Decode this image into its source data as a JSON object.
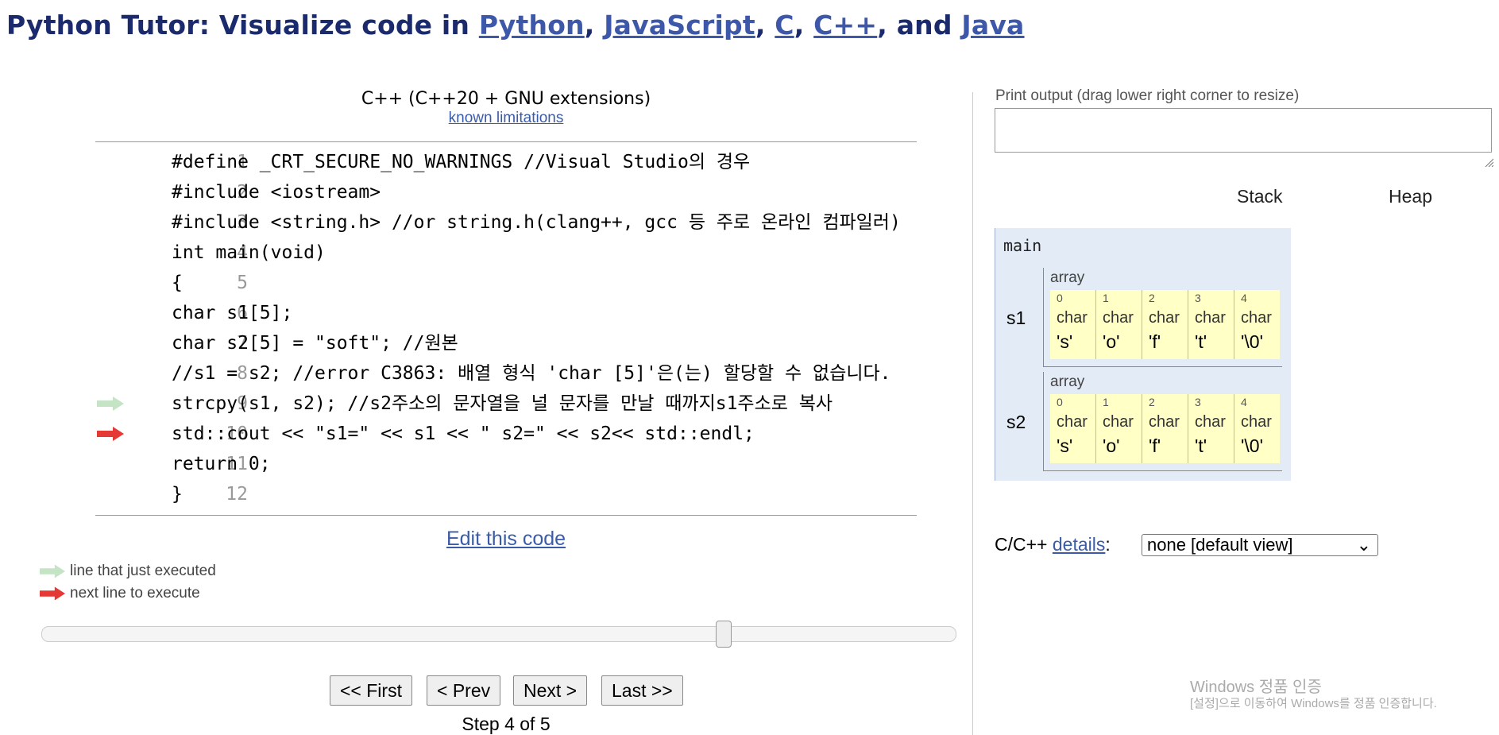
{
  "header": {
    "prefix": "Python Tutor: Visualize code in ",
    "links": [
      "Python",
      "JavaScript",
      "C",
      "C++",
      "Java"
    ],
    "sep1": ", ",
    "sep2": ", ",
    "sep3": ", ",
    "sep4": ", and "
  },
  "editor": {
    "language": "C++ (C++20 + GNU extensions)",
    "limitations_link": "known limitations",
    "lines": [
      {
        "num": "1",
        "code": "#define _CRT_SECURE_NO_WARNINGS //Visual Studio의 경우"
      },
      {
        "num": "2",
        "code": "#include <iostream>"
      },
      {
        "num": "3",
        "code": "#include <string.h> //or string.h(clang++, gcc 등 주로 온라인 컴파일러)"
      },
      {
        "num": "4",
        "code": "int main(void)"
      },
      {
        "num": "5",
        "code": "{"
      },
      {
        "num": "6",
        "code": "char s1[5];"
      },
      {
        "num": "7",
        "code": "char s2[5] = \"soft\"; //원본"
      },
      {
        "num": "8",
        "code": "//s1 = s2; //error C3863: 배열 형식 'char [5]'은(는) 할당할 수 없습니다."
      },
      {
        "num": "9",
        "code": "strcpy(s1, s2); //s2주소의 문자열을 널 문자를 만날 때까지s1주소로 복사"
      },
      {
        "num": "10",
        "code": "std::cout << \"s1=\" << s1 << \" s2=\" << s2<< std::endl;"
      },
      {
        "num": "11",
        "code": "return 0;"
      },
      {
        "num": "12",
        "code": "}"
      }
    ],
    "edit_link": "Edit this code"
  },
  "legend": {
    "executed": "line that just executed",
    "next": "next line to execute",
    "executed_color": "#c5e3c5",
    "next_color": "#e53935"
  },
  "navigation": {
    "first": "<< First",
    "prev": "< Prev",
    "next": "Next >",
    "last": "Last >>",
    "step_text": "Step 4 of 5",
    "progress": 0.75
  },
  "output": {
    "print_label": "Print output (drag lower right corner to resize)",
    "print_value": ""
  },
  "viz": {
    "stack_label": "Stack",
    "heap_label": "Heap",
    "frame_name": "main",
    "variables": [
      {
        "name": "s1",
        "kind": "array",
        "cells": [
          {
            "index": "0",
            "type": "char",
            "value": "'s'"
          },
          {
            "index": "1",
            "type": "char",
            "value": "'o'"
          },
          {
            "index": "2",
            "type": "char",
            "value": "'f'"
          },
          {
            "index": "3",
            "type": "char",
            "value": "'t'"
          },
          {
            "index": "4",
            "type": "char",
            "value": "'\\0'"
          }
        ]
      },
      {
        "name": "s2",
        "kind": "array",
        "cells": [
          {
            "index": "0",
            "type": "char",
            "value": "'s'"
          },
          {
            "index": "1",
            "type": "char",
            "value": "'o'"
          },
          {
            "index": "2",
            "type": "char",
            "value": "'f'"
          },
          {
            "index": "3",
            "type": "char",
            "value": "'t'"
          },
          {
            "index": "4",
            "type": "char",
            "value": "'\\0'"
          }
        ]
      }
    ]
  },
  "details": {
    "prefix": "C/C++ ",
    "link": "details",
    "suffix": ":",
    "selected": "none [default view]"
  },
  "watermark": {
    "line1": "Windows 정품 인증",
    "line2": "[설정]으로 이동하여 Windows를 정품 인증합니다."
  }
}
